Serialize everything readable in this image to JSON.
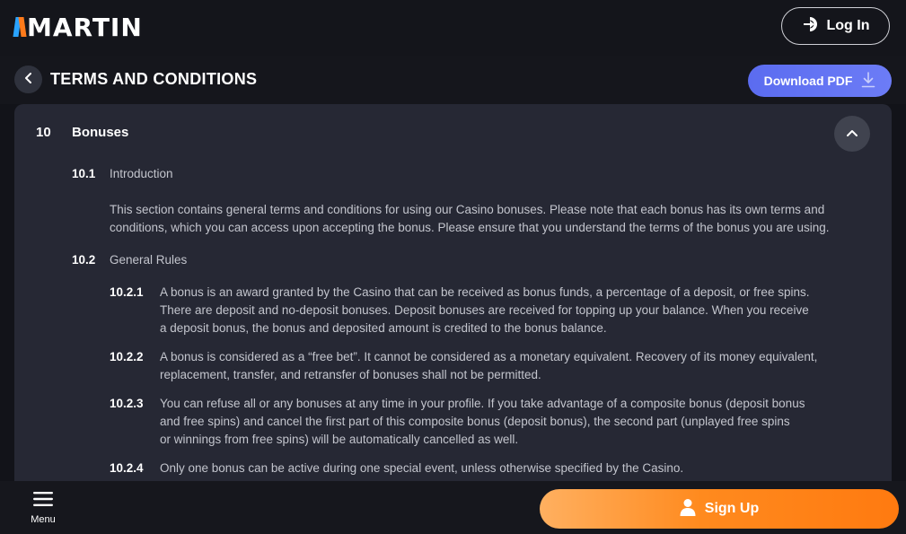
{
  "brand": {
    "name": "MARTIN"
  },
  "topbar": {
    "login_label": "Log In"
  },
  "header": {
    "title": "TERMS AND CONDITIONS",
    "download_label": "Download PDF"
  },
  "section": {
    "number": "10",
    "title": "Bonuses",
    "subsections": [
      {
        "number": "10.1",
        "title": "Introduction",
        "text_lines": [
          "This section contains general terms and conditions for using our Casino bonuses. Please note that each bonus has its own terms and",
          "conditions, which you can access upon accepting the bonus. Please ensure that you understand the terms of the bonus you are using."
        ]
      },
      {
        "number": "10.2",
        "title": "General Rules",
        "rules": [
          {
            "number": "10.2.1",
            "lines": [
              "A bonus is an award granted by the Casino that can be received as bonus funds, a percentage of a deposit, or free spins.",
              "There are deposit and no-deposit bonuses. Deposit bonuses are received for topping up your balance. When you receive",
              "a deposit bonus, the bonus and deposited amount is credited to the bonus balance."
            ]
          },
          {
            "number": "10.2.2",
            "lines": [
              "A bonus is considered as a “free bet”. It cannot be considered as a monetary equivalent. Recovery of its money equivalent,",
              "replacement, transfer, and retransfer of bonuses shall not be permitted."
            ]
          },
          {
            "number": "10.2.3",
            "lines": [
              "You can refuse all or any bonuses at any time in your profile. If you take advantage of a composite bonus (deposit bonus",
              "and free spins) and cancel the first part of this composite bonus (deposit bonus), the second part (unplayed free spins",
              "or winnings from free spins) will be automatically cancelled as well."
            ]
          },
          {
            "number": "10.2.4",
            "lines": [
              "Only one bonus can be active during one special event, unless otherwise specified by the Casino."
            ]
          }
        ]
      }
    ]
  },
  "bottombar": {
    "menu_label": "Menu",
    "signup_label": "Sign Up"
  },
  "icons": {
    "login": "login-arrow-icon",
    "back": "chevron-left-icon",
    "download": "download-icon",
    "collapse": "chevron-up-icon",
    "menu": "hamburger-icon",
    "signup": "user-icon"
  },
  "colors": {
    "background": "#121319",
    "panel": "#262834",
    "accent_blue": "#5b6cf0",
    "accent_orange": "#ff8a1e",
    "logo_blue": "#2aa3ff",
    "logo_orange": "#ff7a1a"
  }
}
